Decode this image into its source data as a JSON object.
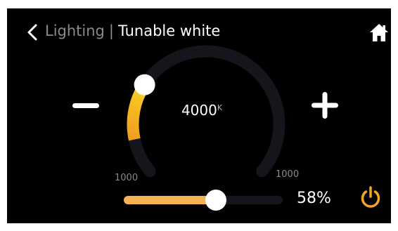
{
  "header": {
    "back_icon": "chevron-left-icon",
    "parent_label": "Lighting",
    "separator": "|",
    "title": "Tunable white",
    "home_icon": "home-icon"
  },
  "controls": {
    "decrease_icon": "minus-icon",
    "increase_icon": "plus-icon",
    "power_icon": "power-icon"
  },
  "color_temp": {
    "value": "4000",
    "unit": "K",
    "min_label": "1000",
    "max_label": "1000",
    "level": 0.28
  },
  "brightness": {
    "label": "58%",
    "percent": 58
  },
  "colors": {
    "background": "#000000",
    "accent": "#f4b253",
    "gradient_start": "#f0a020",
    "gradient_end": "#fff12a",
    "track": "#15161b",
    "muted_text": "#8a8a8a",
    "power": "#f5a623"
  }
}
